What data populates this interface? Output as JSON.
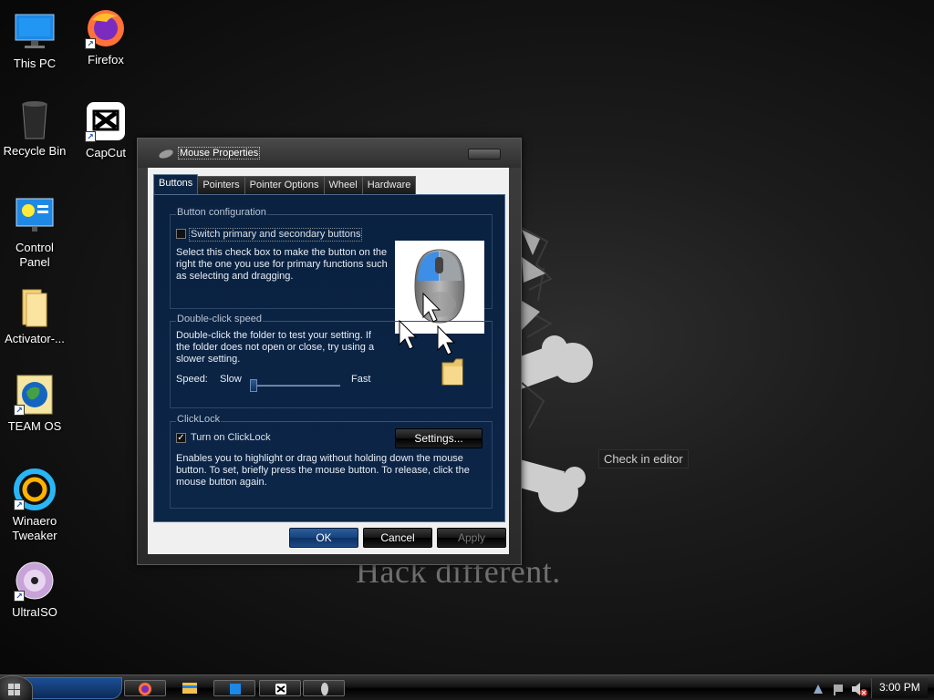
{
  "desktop": {
    "wallpaper_text": "Hack different.",
    "tooltip": "Check in editor",
    "icons": [
      {
        "label": "This PC",
        "icon": "monitor-icon"
      },
      {
        "label": "Firefox",
        "icon": "firefox-icon"
      },
      {
        "label": "Recycle Bin",
        "icon": "recycle-bin-icon"
      },
      {
        "label": "CapCut",
        "icon": "capcut-icon"
      },
      {
        "label": "Control Panel",
        "icon": "control-panel-icon"
      },
      {
        "label": "Activator-...",
        "icon": "folder-icon"
      },
      {
        "label": "TEAM OS",
        "icon": "globe-icon"
      },
      {
        "label": "Winaero Tweaker",
        "icon": "winaero-icon"
      },
      {
        "label": "UltraISO",
        "icon": "disc-icon"
      }
    ]
  },
  "dialog": {
    "title": "Mouse Properties",
    "tabs": [
      "Buttons",
      "Pointers",
      "Pointer Options",
      "Wheel",
      "Hardware"
    ],
    "active_tab": "Buttons",
    "button_config": {
      "title": "Button configuration",
      "checkbox_label": "Switch primary and secondary buttons",
      "checked": false,
      "description": "Select this check box to make the button on the right the one you use for primary functions such as selecting and dragging."
    },
    "double_click": {
      "title": "Double-click speed",
      "description": "Double-click the folder to test your setting. If the folder does not open or close, try using a slower setting.",
      "speed_label": "Speed:",
      "slow_label": "Slow",
      "fast_label": "Fast",
      "speed_value": 0.02
    },
    "clicklock": {
      "title": "ClickLock",
      "checkbox_label": "Turn on ClickLock",
      "checked": true,
      "settings_button": "Settings...",
      "description": "Enables you to highlight or drag without holding down the mouse button. To set, briefly press the mouse button. To release, click the mouse button again."
    },
    "buttons": {
      "ok": "OK",
      "cancel": "Cancel",
      "apply": "Apply"
    }
  },
  "taskbar": {
    "clock": "3:00 PM"
  },
  "colors": {
    "panel_bg": "#0b2344",
    "accent_blue": "#1d4a86"
  }
}
